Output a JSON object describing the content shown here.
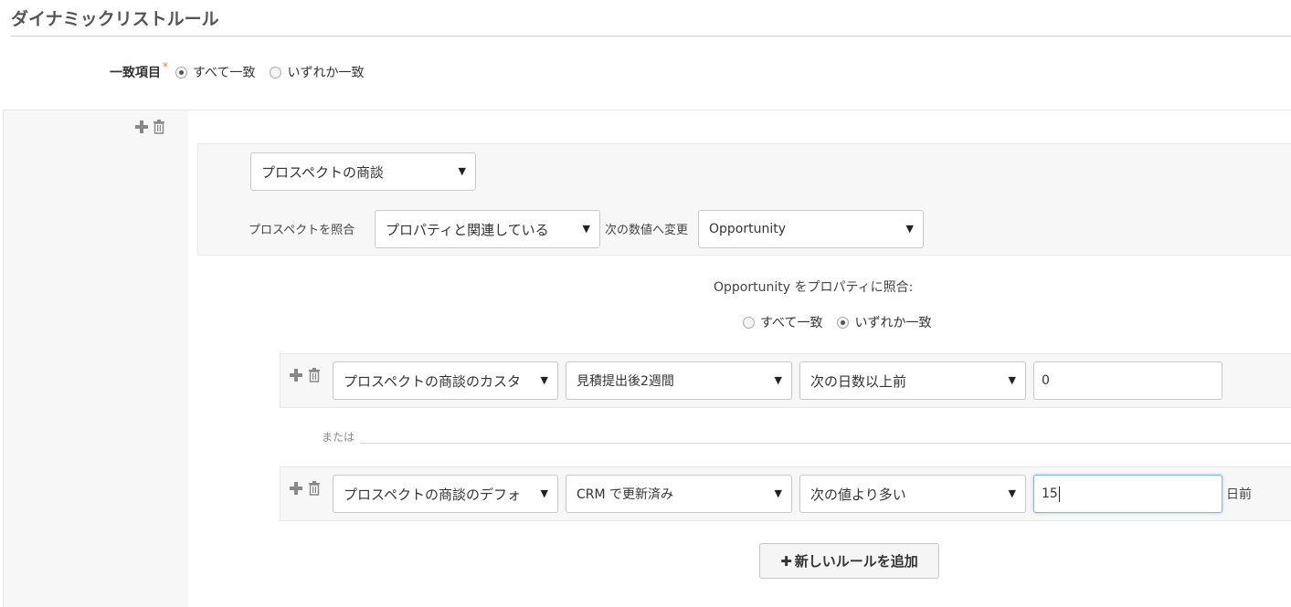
{
  "page": {
    "title": "ダイナミックリストルール"
  },
  "match": {
    "label": "一致項目",
    "required_mark": "*",
    "options": [
      "すべて一致",
      "いずれか一致"
    ],
    "selected": 0
  },
  "group": {
    "object_select": "プロスペクトの商談",
    "match_prospect_label": "プロスペクトを照合",
    "relation_select": "プロパティと関連している",
    "change_to_label": "次の数値へ変更",
    "target_select": "Opportunity"
  },
  "property_match": {
    "heading": "Opportunity をプロパティに照合:",
    "options": [
      "すべて一致",
      "いずれか一致"
    ],
    "selected": 1
  },
  "rules": [
    {
      "field": "プロスペクトの商談のカスタ",
      "property": "見積提出後2週間",
      "operator": "次の日数以上前",
      "value": "0",
      "suffix": ""
    },
    {
      "field": "プロスペクトの商談のデフォ",
      "property": "CRM で更新済み",
      "operator": "次の値より多い",
      "value": "15",
      "suffix": "日前"
    }
  ],
  "or_label": "または",
  "add_rule_button": {
    "icon": "plus-icon",
    "label": "新しいルールを追加"
  },
  "icons": {
    "add": "plus-icon",
    "delete": "trash-icon",
    "dropdown": "caret-down-icon"
  }
}
